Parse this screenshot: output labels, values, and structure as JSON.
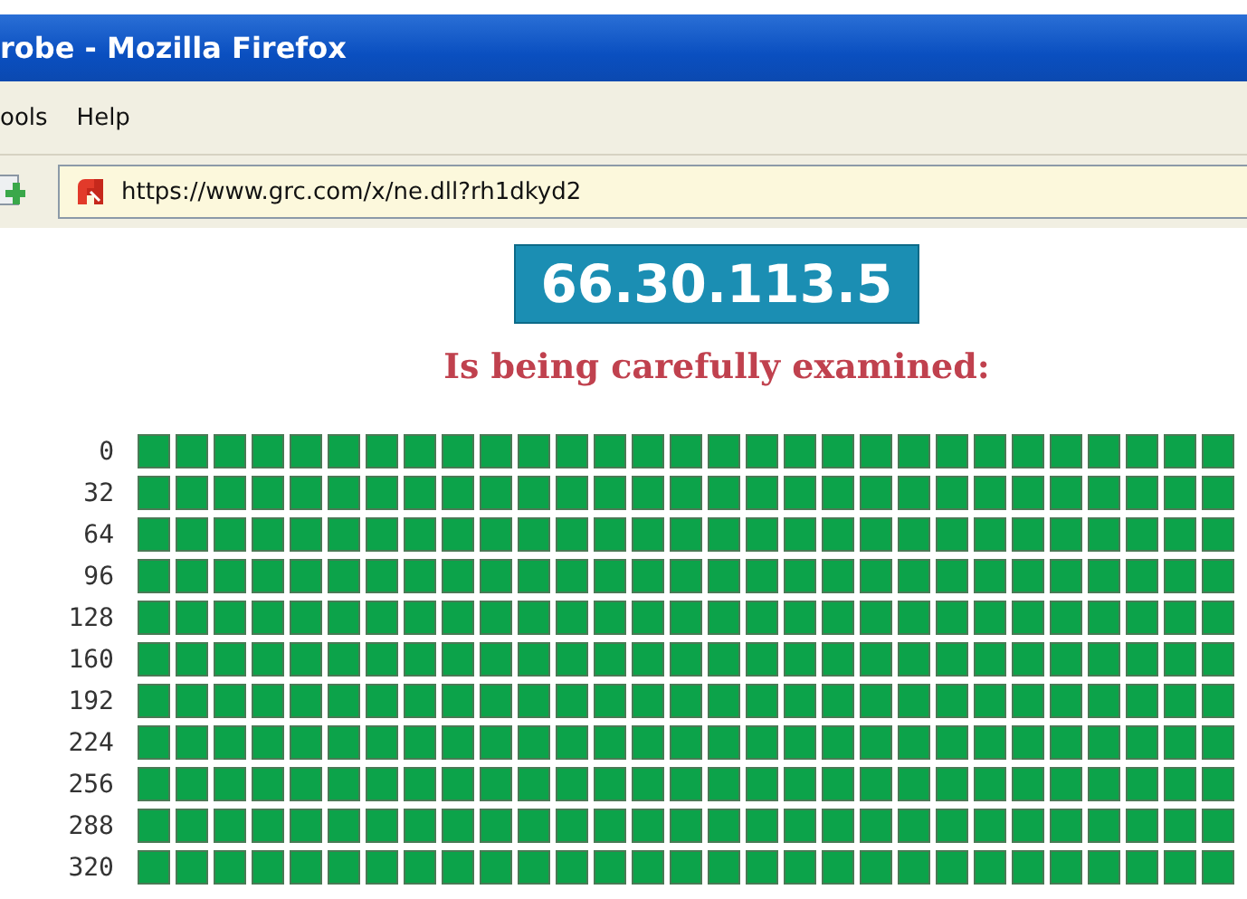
{
  "window": {
    "title": "robe - Mozilla Firefox"
  },
  "menu": [
    {
      "label": "ools"
    },
    {
      "label": "Help"
    }
  ],
  "address_bar": {
    "value": "https://www.grc.com/x/ne.dll?rh1dkyd2"
  },
  "page": {
    "ip_address": "66.30.113.5",
    "subtitle": "Is being carefully examined:",
    "rows": [
      {
        "label": "0",
        "color": "#0ca34a"
      },
      {
        "label": "32",
        "color": "#0ca34a"
      },
      {
        "label": "64",
        "color": "#0ca34a"
      },
      {
        "label": "96",
        "color": "#0ca34a"
      },
      {
        "label": "128",
        "color": "#0ca34a"
      },
      {
        "label": "160",
        "color": "#0ca34a"
      },
      {
        "label": "192",
        "color": "#0ca34a"
      },
      {
        "label": "224",
        "color": "#0ca34a"
      },
      {
        "label": "256",
        "color": "#0ca34a"
      },
      {
        "label": "288",
        "color": "#0ca34a"
      },
      {
        "label": "320",
        "color": "#0ca34a"
      }
    ]
  }
}
